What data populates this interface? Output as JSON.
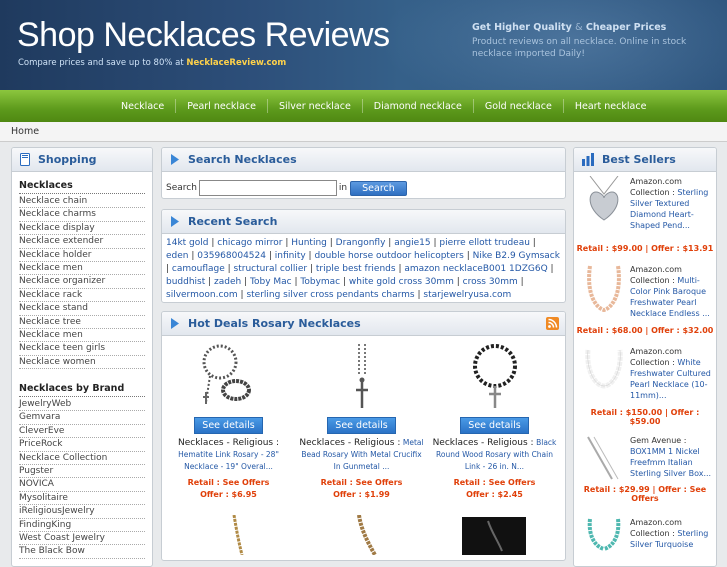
{
  "header": {
    "title": "Shop Necklaces Reviews",
    "tagline_prefix": "Compare prices and save up to 80% at",
    "tagline_site": "NecklaceReview.com",
    "promo_title_a": "Get Higher Quality",
    "promo_title_amp": "&",
    "promo_title_b": "Cheaper Prices",
    "promo_text": "Product reviews on all necklace. Online in stock necklace imported Daily!"
  },
  "nav": [
    "Necklace",
    "Pearl necklace",
    "Silver necklace",
    "Diamond necklace",
    "Gold necklace",
    "Heart necklace"
  ],
  "breadcrumb": "Home",
  "shopping": {
    "title": "Shopping",
    "section1_title": "Necklaces",
    "section1_items": [
      "Necklace chain",
      "Necklace charms",
      "Necklace display",
      "Necklace extender",
      "Necklace holder",
      "Necklace men",
      "Necklace organizer",
      "Necklace rack",
      "Necklace stand",
      "Necklace tree",
      "Necklace men",
      "Necklace teen girls",
      "Necklace women"
    ],
    "section2_title": "Necklaces by Brand",
    "section2_items": [
      "JewelryWeb",
      "Gemvara",
      "CleverEve",
      "PriceRock",
      "Necklace Collection",
      "Pugster",
      "NOVICA",
      "Mysolitaire",
      "iReligiousJewelry",
      "FindingKing",
      "West Coast Jewelry",
      "The Black Bow"
    ]
  },
  "search": {
    "title": "Search Necklaces",
    "label": "Search",
    "in_label": "in",
    "button": "Search",
    "input_value": ""
  },
  "recent": {
    "title": "Recent Search",
    "items": [
      "14kt gold",
      "chicago mirror",
      "Hunting",
      "Drangonfly",
      "angie15",
      "pierre ellott trudeau",
      "eden",
      "035968004524",
      "infinity",
      "double horse outdoor helicopters",
      "Nike B2.9 Gymsack",
      "camouflage",
      "structural collier",
      "triple best friends",
      "amazon necklaceB001 1DZG6Q",
      "buddhist",
      "zadeh",
      "Toby Mac",
      "Tobymac",
      "white gold cross 30mm",
      "cross 30mm",
      "silvermoon.com",
      "sterling silver cross pendants charms",
      "starjewelryusa.com"
    ]
  },
  "deals": {
    "title": "Hot Deals Rosary Necklaces",
    "button_label": "See details",
    "items": [
      {
        "category": "Necklaces - Religious :",
        "name": "Hematite Link Rosary - 28\" Necklace - 19\" Overal...",
        "retail": "Retail : See Offers",
        "offer": "Offer : $6.95"
      },
      {
        "category": "Necklaces - Religious :",
        "name": "Metal Bead Rosary With Metal Crucifix In Gunmetal ...",
        "retail": "Retail : See Offers",
        "offer": "Offer : $1.99"
      },
      {
        "category": "Necklaces - Religious :",
        "name": "Black Round Wood Rosary with Chain Link - 26 in. N...",
        "retail": "Retail : See Offers",
        "offer": "Offer : $2.45"
      }
    ]
  },
  "bestsellers": {
    "title": "Best Sellers",
    "items": [
      {
        "seller": "Amazon.com Collection :",
        "name": "Sterling Silver Textured Diamond Heart-Shaped Pend...",
        "price": "Retail : $99.00 | Offer : $13.91"
      },
      {
        "seller": "Amazon.com Collection :",
        "name": "Multi-Color Pink Baroque Freshwater Pearl Necklace Endless ...",
        "price": "Retail : $68.00 | Offer : $32.00"
      },
      {
        "seller": "Amazon.com Collection :",
        "name": "White Freshwater Cultured Pearl Necklace (10-11mm)...",
        "price": "Retail : $150.00 | Offer : $59.00"
      },
      {
        "seller": "Gem Avenue :",
        "name": "BOX1MM 1 Nickel Freefmm Italian Sterling Silver Box...",
        "price": "Retail : $29.99 | Offer : See Offers"
      },
      {
        "seller": "Amazon.com Collection :",
        "name": "Sterling Silver Turquoise",
        "price": ""
      }
    ]
  },
  "colors": {
    "brand_blue": "#2a5c9a",
    "nav_green": "#6aa824",
    "price_orange": "#e0400a",
    "header_bg": "#2d4f7a"
  }
}
